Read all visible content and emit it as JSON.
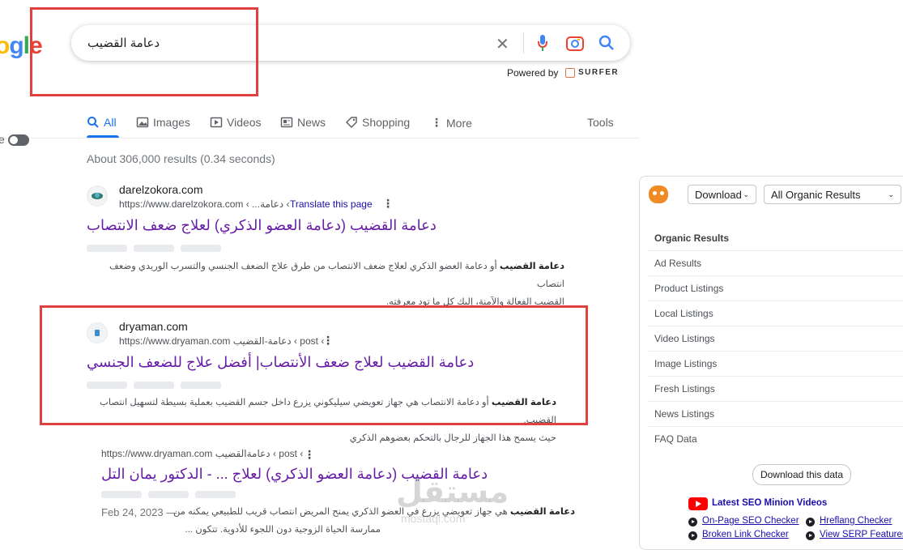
{
  "logo": {
    "text": "ogle"
  },
  "search": {
    "query": "دعامة القضيب",
    "powered_by": "Powered by",
    "surfer": "SURFER"
  },
  "tabs": [
    {
      "label": "All"
    },
    {
      "label": "Images"
    },
    {
      "label": "Videos"
    },
    {
      "label": "News"
    },
    {
      "label": "Shopping"
    },
    {
      "label": "More"
    },
    {
      "label": "Tools"
    }
  ],
  "toggle_label": "e",
  "stats": "About 306,000 results (0.34 seconds)",
  "results": [
    {
      "site": "darelzokora.com",
      "url_base": "https://www.darelzokora.com",
      "url_path": "› دعامة... ›",
      "translate": "Translate this page",
      "title": "دعامة القضيب (دعامة العضو الذكري) لعلاج ضعف الانتصاب",
      "snippet_bold": "دعامة القضيب",
      "snippet_line1": " أو دعامة العضو الذكري لعلاج ضعف الانتصاب من طرق علاج الضعف الجنسي والتسرب الوريدي وضعف انتصاب",
      "snippet_line2": "القضيب الفعالة والآمنة، إليك كل ما تود معرفته."
    },
    {
      "site": "dryaman.com",
      "url_base": "https://www.dryaman.com",
      "url_path": "› post › دعامة-القضيب",
      "title": "دعامة القضيب لعلاج ضعف الأنتصاب| أفضل علاج للضعف الجنسي",
      "snippet_bold": "دعامة القضيب",
      "snippet_line1": " أو دعامة الانتصاب هي جهاز تعويضي سيليكوني يزرع داخل جسم القضيب بعملية بسيطة لتسهيل انتصاب القضيب.",
      "snippet_line2": "حيث يسمح هذا الجهاز للرجال بالتحكم بعضوهم الذكري"
    },
    {
      "url_base": "https://www.dryaman.com",
      "url_path": "› post › دعامةالقضيب",
      "title": "دعامة القضيب (دعامة العضو الذكري) لعلاج ... - الدكتور يمان التل",
      "date": "Feb 24, 2023 —",
      "snippet_bold": "دعامة القضيب",
      "snippet_line1": " هي جهاز تعويضي يزرع في العضو الذكري يمنح المريض انتصاب قريب للطبيعي يمكنه من",
      "snippet_line2": "ممارسة الحياة الزوجية دون اللجوء للأدوية. تتكون ..."
    }
  ],
  "panel": {
    "download": "Download",
    "filter": "All Organic Results",
    "menu": [
      "Organic Results",
      "Ad Results",
      "Product Listings",
      "Local Listings",
      "Video Listings",
      "Image Listings",
      "Fresh Listings",
      "News Listings",
      "FAQ Data"
    ],
    "download_data": "Download this data",
    "yt_link": "Latest SEO Minion Videos",
    "links": [
      "On-Page SEO Checker",
      "Hreflang Checker",
      "Broken Link Checker",
      "View SERP Features"
    ]
  },
  "watermark": {
    "text": "مستقل",
    "sub": "mostaql.com"
  },
  "colors": {
    "accent": "#1a73e8",
    "visited_title": "#681da8",
    "highlight_box": "#e0413f"
  }
}
